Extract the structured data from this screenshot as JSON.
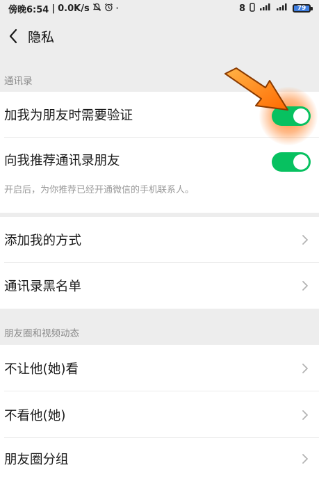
{
  "status_bar": {
    "time": "傍晚6:54",
    "network_speed": "0.0K/s",
    "separator": "|",
    "right_indicators": "8",
    "battery_level": "79",
    "left_icons": [
      "mute-icon",
      "alarm-icon",
      "dot-icon"
    ],
    "right_icons": [
      "sim-icon",
      "signal-icon",
      "signal-icon",
      "battery-icon"
    ]
  },
  "header": {
    "title": "隐私",
    "back_icon": "chevron-left-icon"
  },
  "sections": {
    "contacts": {
      "header": "通讯录",
      "items": [
        {
          "label": "加我为朋友时需要验证",
          "toggle": true
        },
        {
          "label": "向我推荐通讯录朋友",
          "toggle": true,
          "hint": "开启后，为你推荐已经开通微信的手机联系人。"
        }
      ]
    },
    "add_methods": {
      "items": [
        {
          "label": "添加我的方式"
        },
        {
          "label": "通讯录黑名单"
        }
      ]
    },
    "moments": {
      "header": "朋友圈和视频动态",
      "items": [
        {
          "label": "不让他(她)看"
        },
        {
          "label": "不看他(她)"
        },
        {
          "label": "朋友圈分组"
        }
      ]
    }
  },
  "colors": {
    "toggle_on": "#07c160",
    "page_bg": "#ededed",
    "card_bg": "#ffffff",
    "annotation_arrow": "#ff7a1a"
  }
}
